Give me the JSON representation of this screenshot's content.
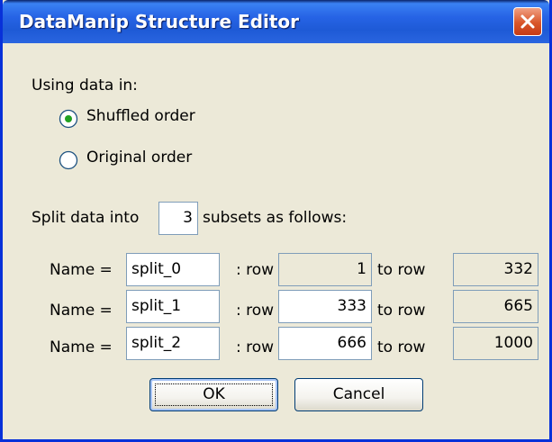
{
  "window": {
    "title": "DataManip Structure Editor"
  },
  "using_data": {
    "label": "Using data in:",
    "options": [
      {
        "label": "Shuffled order",
        "selected": true
      },
      {
        "label": "Original order",
        "selected": false
      }
    ]
  },
  "split": {
    "prefix": "Split data into",
    "count": "3",
    "suffix": "subsets as follows:"
  },
  "rows": [
    {
      "name_label": "Name =",
      "name": "split_0",
      "row_label": ": row",
      "from": "1",
      "to_label": "to row",
      "to": "332"
    },
    {
      "name_label": "Name =",
      "name": "split_1",
      "row_label": ": row",
      "from": "333",
      "to_label": "to row",
      "to": "665"
    },
    {
      "name_label": "Name =",
      "name": "split_2",
      "row_label": ": row",
      "from": "666",
      "to_label": "to row",
      "to": "1000"
    }
  ],
  "buttons": {
    "ok": "OK",
    "cancel": "Cancel"
  }
}
